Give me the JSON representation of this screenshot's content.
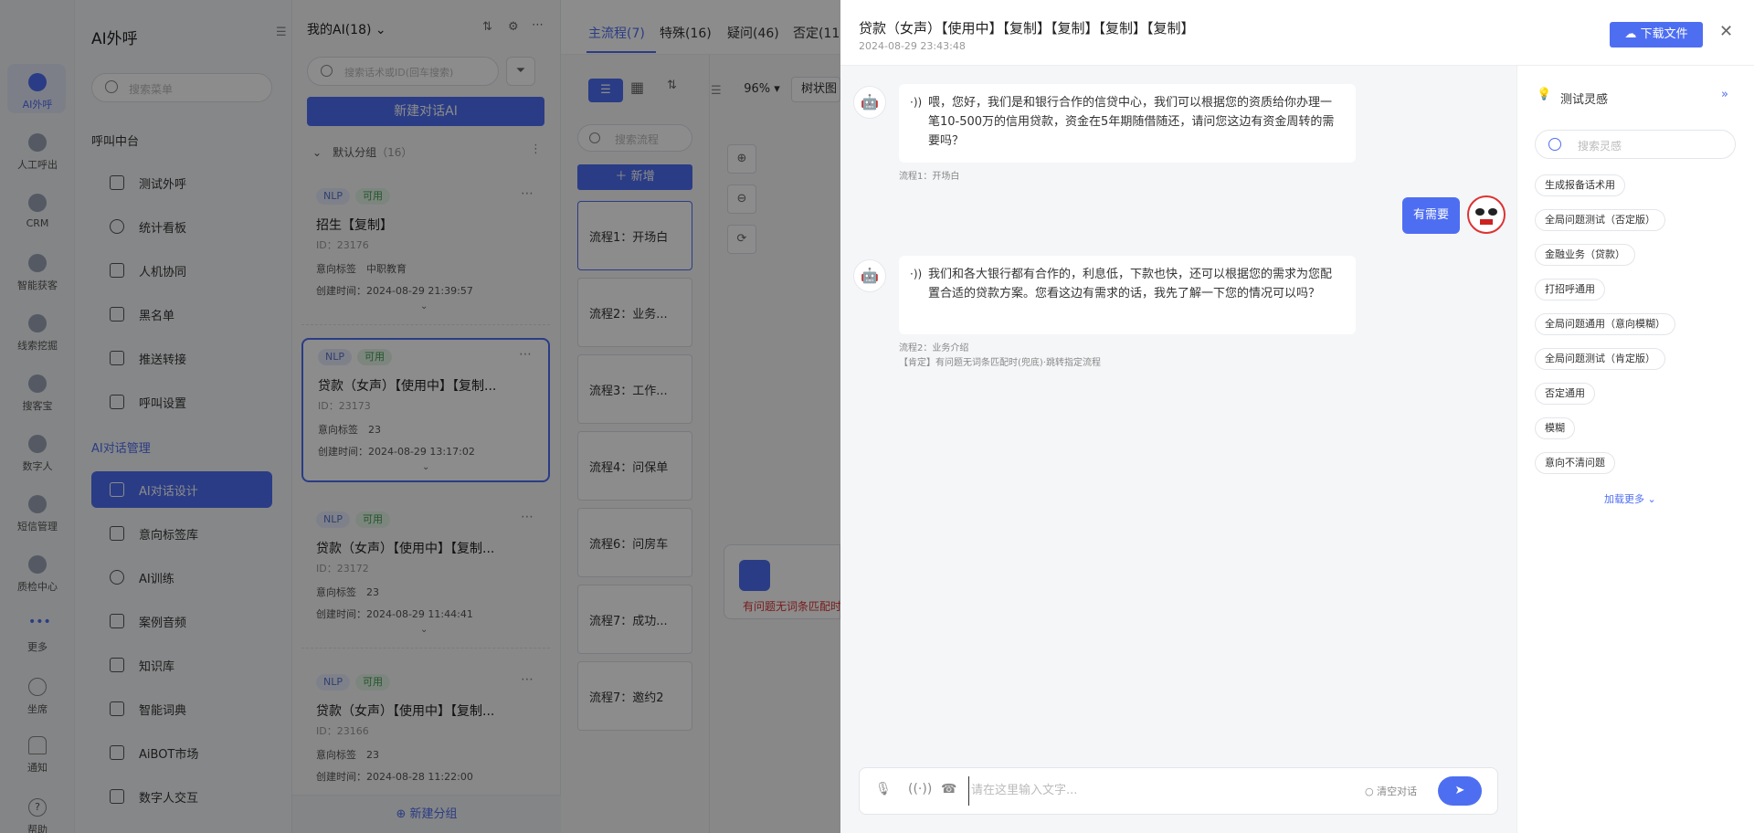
{
  "rail": {
    "items": [
      {
        "label": "AI外呼",
        "active": true
      },
      {
        "label": "人工呼出"
      },
      {
        "label": "CRM"
      },
      {
        "label": "智能获客"
      },
      {
        "label": "线索挖掘"
      },
      {
        "label": "搜客宝"
      },
      {
        "label": "数字人"
      },
      {
        "label": "短信管理"
      },
      {
        "label": "质检中心"
      },
      {
        "label": "更多"
      },
      {
        "label": "坐席"
      },
      {
        "label": "通知"
      },
      {
        "label": "帮助"
      }
    ]
  },
  "menu": {
    "title": "AI外呼",
    "search_placeholder": "搜索菜单",
    "group1": "呼叫中台",
    "group1_items": [
      "测试外呼",
      "统计看板",
      "人机协同",
      "黑名单",
      "推送转接",
      "呼叫设置"
    ],
    "group2": "AI对话管理",
    "group2_items": [
      "AI对话设计",
      "意向标签库",
      "AI训练",
      "案例音频",
      "知识库",
      "智能词典",
      "AiBOT市场",
      "数字人交互"
    ]
  },
  "ailist": {
    "header": "我的AI(18)",
    "search_placeholder": "搜索话术或ID(回车搜索)",
    "new_button": "新建对话AI",
    "group_label": "默认分组",
    "group_count": "（16）",
    "new_group": "新建分组",
    "tag_nlp": "NLP",
    "tag_ok": "可用",
    "cards": [
      {
        "name": "招生【复制】",
        "id": "ID：23176",
        "label": "意向标签　中职教育",
        "time": "创建时间：2024-08-29 21:39:57"
      },
      {
        "name": "贷款（女声）【使用中】【复制...",
        "id": "ID：23173",
        "label": "意向标签　23",
        "time": "创建时间：2024-08-29 13:17:02"
      },
      {
        "name": "贷款（女声）【使用中】【复制...",
        "id": "ID：23172",
        "label": "意向标签　23",
        "time": "创建时间：2024-08-29 11:44:41"
      },
      {
        "name": "贷款（女声）【使用中】【复制...",
        "id": "ID：23166",
        "label": "意向标签　23",
        "time": "创建时间：2024-08-28 11:22:00"
      }
    ]
  },
  "flow": {
    "tabs": [
      "主流程(7)",
      "特殊(16)",
      "疑问(46)",
      "否定(11"
    ],
    "search_placeholder": "搜索流程",
    "add_button": "新增",
    "zoom": "96%",
    "view_label": "树状图",
    "items": [
      "流程1：开场白",
      "流程2：业务...",
      "流程3：工作...",
      "流程4：问保单",
      "流程6：问房车",
      "流程7：成功...",
      "流程7：邀约2"
    ],
    "node_text": "有问题无词条匹配时"
  },
  "drawer": {
    "title": "贷款（女声）【使用中】【复制】【复制】【复制】【复制】",
    "subtitle": "2024-08-29 23:43:48",
    "download": "下载文件",
    "messages": [
      {
        "from": "bot",
        "text": "喂，您好，我们是和银行合作的信贷中心，我们可以根据您的资质给你办理一笔10-500万的信用贷款，资金在5年期随借随还，请问您这边有资金周转的需要吗？",
        "meta": "流程1：开场白"
      },
      {
        "from": "user",
        "text": "有需要"
      },
      {
        "from": "bot",
        "text": "我们和各大银行都有合作的，利息低，下款也快，还可以根据您的需求为您配置合适的贷款方案。您看这边有需求的话，我先了解一下您的情况可以吗？",
        "meta": "流程2：业务介绍",
        "meta2": "【肯定】有问题无词条匹配时(兜底)·跳转指定流程"
      }
    ],
    "input_placeholder": "请在这里输入文字...",
    "clear": "清空对话"
  },
  "inspire": {
    "title": "测试灵感",
    "search_placeholder": "搜索灵感",
    "chips": [
      "生成报备话术用",
      "全局问题测试（否定版）",
      "金融业务（贷款）",
      "打招呼通用",
      "全局问题通用（意向模糊）",
      "全局问题测试（肯定版）",
      "否定通用",
      "模糊",
      "意向不清问题"
    ],
    "more": "加载更多"
  },
  "colors": {
    "accent": "#4e6ef2",
    "overlay": "rgba(0,0,0,0.45)"
  }
}
